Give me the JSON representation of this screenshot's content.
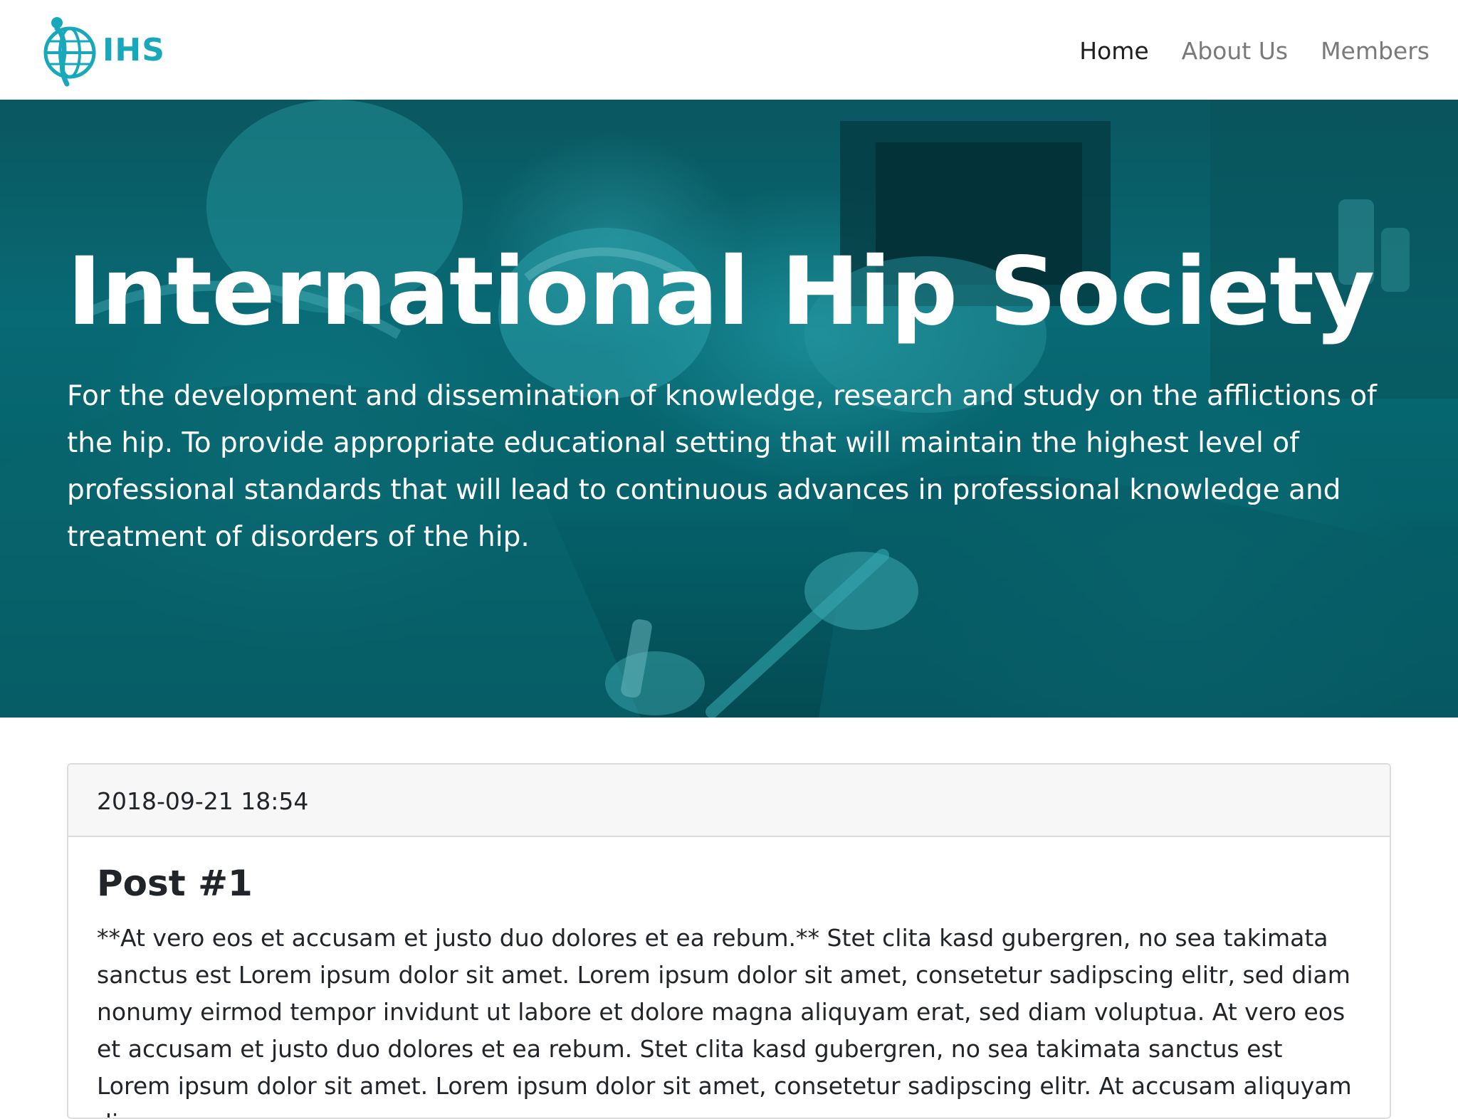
{
  "brand": {
    "logo_text": "IHS",
    "logo_icon": "globe-with-figure-icon",
    "accent_color": "#17a9bb"
  },
  "nav": {
    "items": [
      {
        "label": "Home",
        "active": true
      },
      {
        "label": "About Us",
        "active": false
      },
      {
        "label": "Members",
        "active": false
      }
    ]
  },
  "hero": {
    "title": "International Hip Society",
    "lead": "For the development and dissemination of knowledge, research and study on the afflictions of the hip. To provide appropriate educational setting that will maintain the highest level of professional standards that will lead to continuous advances in professional knowledge and treatment of disorders of the hip.",
    "tint_color": "#0a7480"
  },
  "post": {
    "timestamp": "2018-09-21 18:54",
    "title": "Post #1",
    "body": "**At vero eos et accusam et justo duo dolores et ea rebum.** Stet clita kasd gubergren, no sea takimata sanctus est Lorem ipsum dolor sit amet. Lorem ipsum dolor sit amet, consetetur sadipscing elitr, sed diam nonumy eirmod tempor invidunt ut labore et dolore magna aliquyam erat, sed diam voluptua. At vero eos et accusam et justo duo dolores et ea rebum. Stet clita kasd gubergren, no sea takimata sanctus est Lorem ipsum dolor sit amet. Lorem ipsum dolor sit amet, consetetur sadipscing elitr. At accusam aliquyam diam"
  }
}
